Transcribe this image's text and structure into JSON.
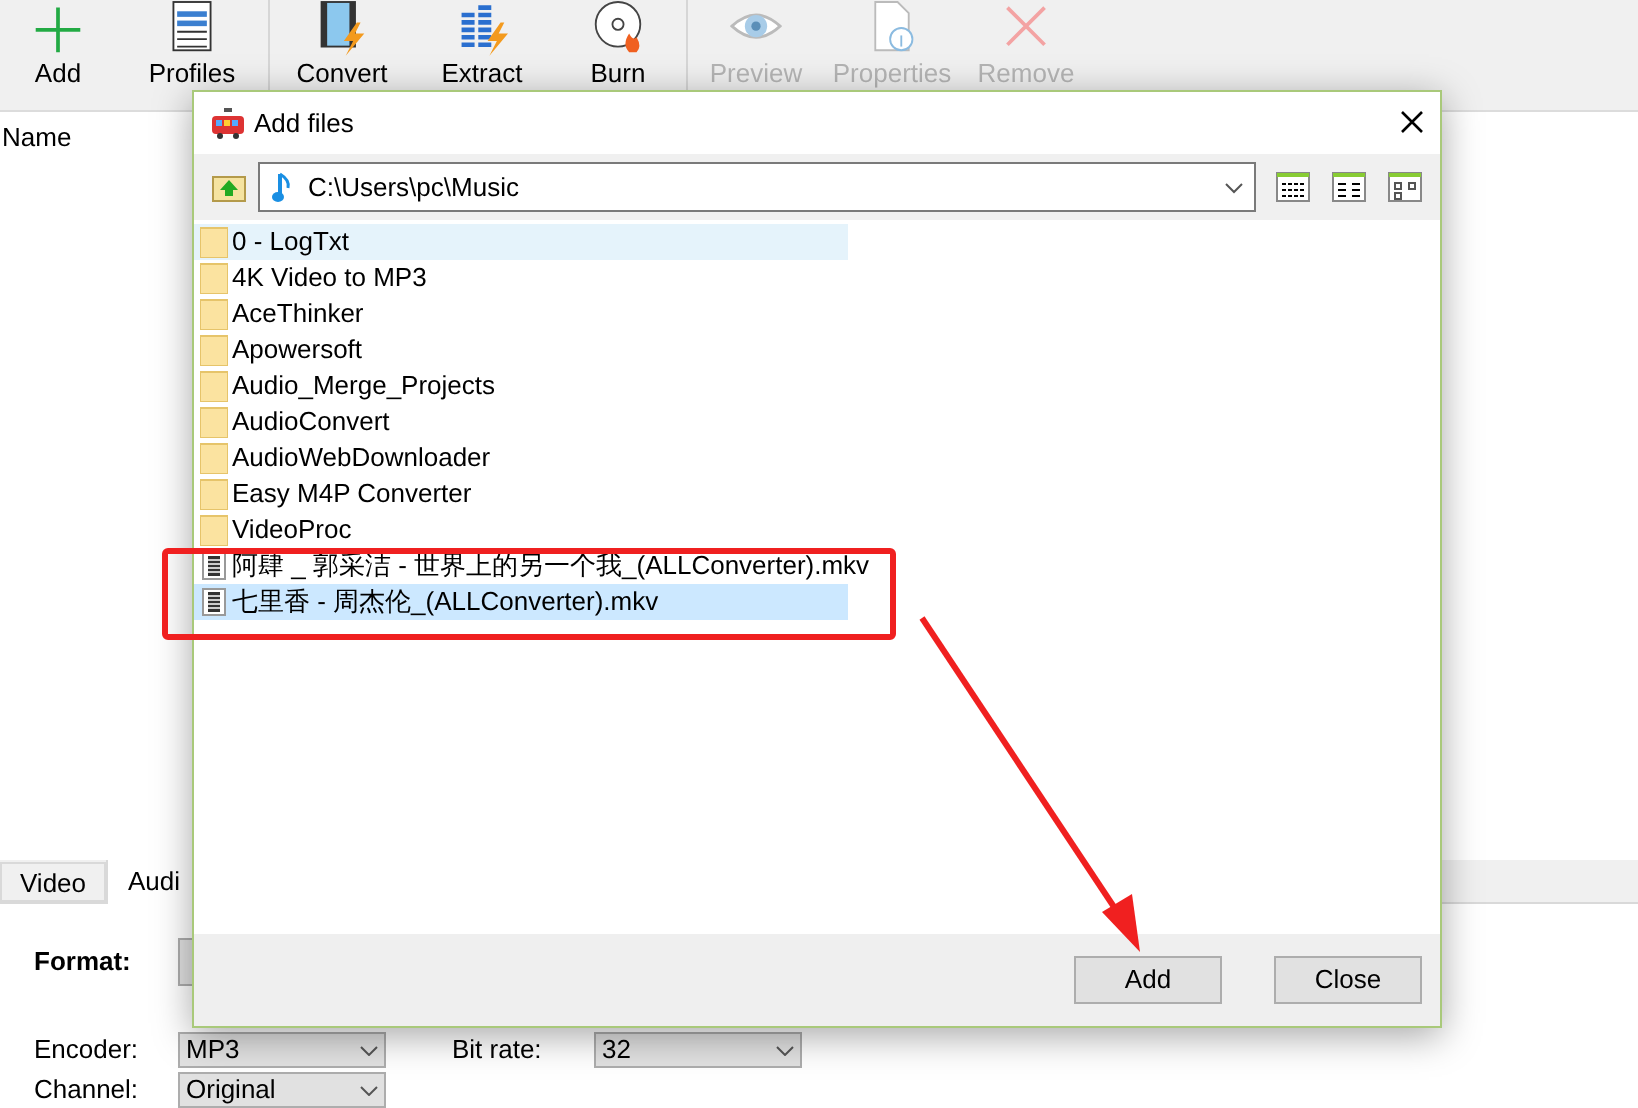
{
  "toolbar": [
    {
      "label": "Add",
      "kind": "add",
      "disabled": false
    },
    {
      "label": "Profiles",
      "kind": "profiles",
      "disabled": false
    },
    {
      "label": "Convert",
      "kind": "convert",
      "disabled": false
    },
    {
      "label": "Extract",
      "kind": "extract",
      "disabled": false
    },
    {
      "label": "Burn",
      "kind": "burn",
      "disabled": false
    },
    {
      "label": "Preview",
      "kind": "preview",
      "disabled": true
    },
    {
      "label": "Properties",
      "kind": "properties",
      "disabled": true
    },
    {
      "label": "Remove",
      "kind": "remove",
      "disabled": true
    }
  ],
  "file_list": {
    "columns": [
      "Name"
    ]
  },
  "dialog": {
    "title": "Add files",
    "path": "C:\\Users\\pc\\Music",
    "items": [
      {
        "name": "0 - LogTxt",
        "kind": "folder",
        "hot": true,
        "selected": false
      },
      {
        "name": "4K Video to MP3",
        "kind": "folder",
        "hot": false,
        "selected": false
      },
      {
        "name": "AceThinker",
        "kind": "folder",
        "hot": false,
        "selected": false
      },
      {
        "name": "Apowersoft",
        "kind": "folder",
        "hot": false,
        "selected": false
      },
      {
        "name": "Audio_Merge_Projects",
        "kind": "folder",
        "hot": false,
        "selected": false
      },
      {
        "name": "AudioConvert",
        "kind": "folder",
        "hot": false,
        "selected": false
      },
      {
        "name": "AudioWebDownloader",
        "kind": "folder",
        "hot": false,
        "selected": false
      },
      {
        "name": "Easy M4P Converter",
        "kind": "folder",
        "hot": false,
        "selected": false
      },
      {
        "name": "VideoProc",
        "kind": "folder",
        "hot": false,
        "selected": false
      },
      {
        "name": "阿肆 _ 郭采洁 - 世界上的另一个我_(ALLConverter).mkv",
        "kind": "video",
        "hot": false,
        "selected": false
      },
      {
        "name": "七里香 - 周杰伦_(ALLConverter).mkv",
        "kind": "video",
        "hot": false,
        "selected": true
      }
    ],
    "buttons": [
      "Add",
      "Close"
    ]
  },
  "tabs": [
    {
      "label": "Video",
      "selected": false
    },
    {
      "label": "Audi",
      "selected": true
    }
  ],
  "settings": [
    {
      "label": "Format:",
      "bold": true
    },
    {
      "label": "Encoder:",
      "bold": false,
      "value": "MP3"
    },
    {
      "label": "Bit rate:",
      "bold": false,
      "value": "32"
    },
    {
      "label": "Channel:",
      "bold": false,
      "value": "Original"
    }
  ]
}
